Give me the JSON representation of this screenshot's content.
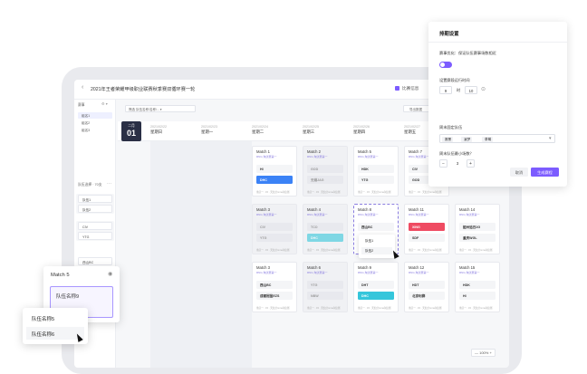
{
  "header": {
    "title": "2021年王者荣耀甲级职业联赛秋季赛双循环赛一轮",
    "ops_label": "比赛信息",
    "export_label": "导出数据"
  },
  "filter": {
    "value": "筛选   队伍名称/名称/...   ▾"
  },
  "sidebar": {
    "heading1": "赛事",
    "items": [
      "组名1",
      "组名2",
      "组名3"
    ],
    "heading2": "队伍选择 · 70支",
    "teams_a": [
      "队伍1",
      "队伍2"
    ],
    "teams_b": [
      "CIV",
      "YTG"
    ],
    "extra": "西山BC"
  },
  "calendar": {
    "month": "二月",
    "day": "01",
    "days": [
      {
        "date": "2021/02/22",
        "week": "星期日"
      },
      {
        "date": "2021/02/23",
        "week": "星期一"
      },
      {
        "date": "2021/02/24",
        "week": "星期二"
      },
      {
        "date": "2021/02/25",
        "week": "星期三"
      },
      {
        "date": "2021/02/26",
        "week": "星期四"
      },
      {
        "date": "2021/02/27",
        "week": "星期五"
      }
    ]
  },
  "matches": [
    {
      "title": "Match 1",
      "sub": "RNG  淘汰赛第一",
      "t1": "HI",
      "t2": "DHC"
    },
    {
      "title": "Match 2",
      "sub": "RNG  淘汰赛第一",
      "t1": "GOD",
      "t2": "无锡JAG"
    },
    {
      "title": "Match 5",
      "sub": "RNG  淘汰赛第一",
      "t1": "HDK",
      "t2": "YTG"
    },
    {
      "title": "Match 7",
      "sub": "RNG  淘汰赛第一",
      "t1": "CIV",
      "t2": "GOD"
    },
    {
      "title": "Match 3",
      "sub": "RNG  淘汰赛第一",
      "t1": "CIV",
      "t2": "YTG"
    },
    {
      "title": "Match 4",
      "sub": "RNG  淘汰赛第一",
      "t1": "TCO",
      "t2": "DHC"
    },
    {
      "title": "Match 8",
      "sub": "RNG  淘汰赛第一",
      "t1": "西山BC",
      "t2": ""
    },
    {
      "title": "Match 11",
      "sub": "RNG  淘汰赛第一",
      "t1": "XING",
      "t2": "SDF"
    },
    {
      "title": "Match 14",
      "sub": "RNG  淘汰赛第一",
      "t1": "韶州追日2G",
      "t2": "重庆WGL"
    },
    {
      "title": "Match 3",
      "sub": "RNG  淘汰赛第一",
      "t1": "西山BC",
      "t2": "成都冠盈EZS"
    },
    {
      "title": "Match 6",
      "sub": "RNG  淘汰赛第一",
      "t1": "YTG",
      "t2": "NBW"
    },
    {
      "title": "Match 9",
      "sub": "RNG  淘汰赛第一",
      "t1": "DHT",
      "t2": "DHC"
    },
    {
      "title": "Match 12",
      "sub": "RNG  淘汰赛第一",
      "t1": "HDT",
      "t2": "北京利群"
    },
    {
      "title": "Match 15",
      "sub": "RNG  淘汰赛第一",
      "t1": "HDK",
      "t2": "HI"
    }
  ],
  "card_footer": "重庆一 · 15 · 天仙分mma淘汰赛",
  "drop": {
    "items": [
      "队伍1",
      "队伍2"
    ]
  },
  "panel": {
    "title": "排期设置",
    "opt_label": "赛事优化：保证队伍赛事场数相近",
    "time_label": "设置赛段运行时间",
    "time_from": "9",
    "time_sep": "时",
    "time_to": "10",
    "fixed_label": "周末固定队伍",
    "tags": [
      "赛黑",
      "凌梦",
      "草莓"
    ],
    "min_label": "周末队伍最小场数？",
    "min_value": "3",
    "cancel": "取消",
    "confirm": "生成赛程"
  },
  "pop": {
    "title": "Match 5",
    "team": "队伍名称9"
  },
  "pop2": {
    "items": [
      "队伍名称5",
      "队伍名称6"
    ]
  },
  "zoom": "— 100%  +",
  "colors": {
    "accent": "#7c5cff",
    "blue": "#3b82f6",
    "red": "#ef4b62",
    "cyan": "#35c6db",
    "dark": "#2a2f45"
  }
}
